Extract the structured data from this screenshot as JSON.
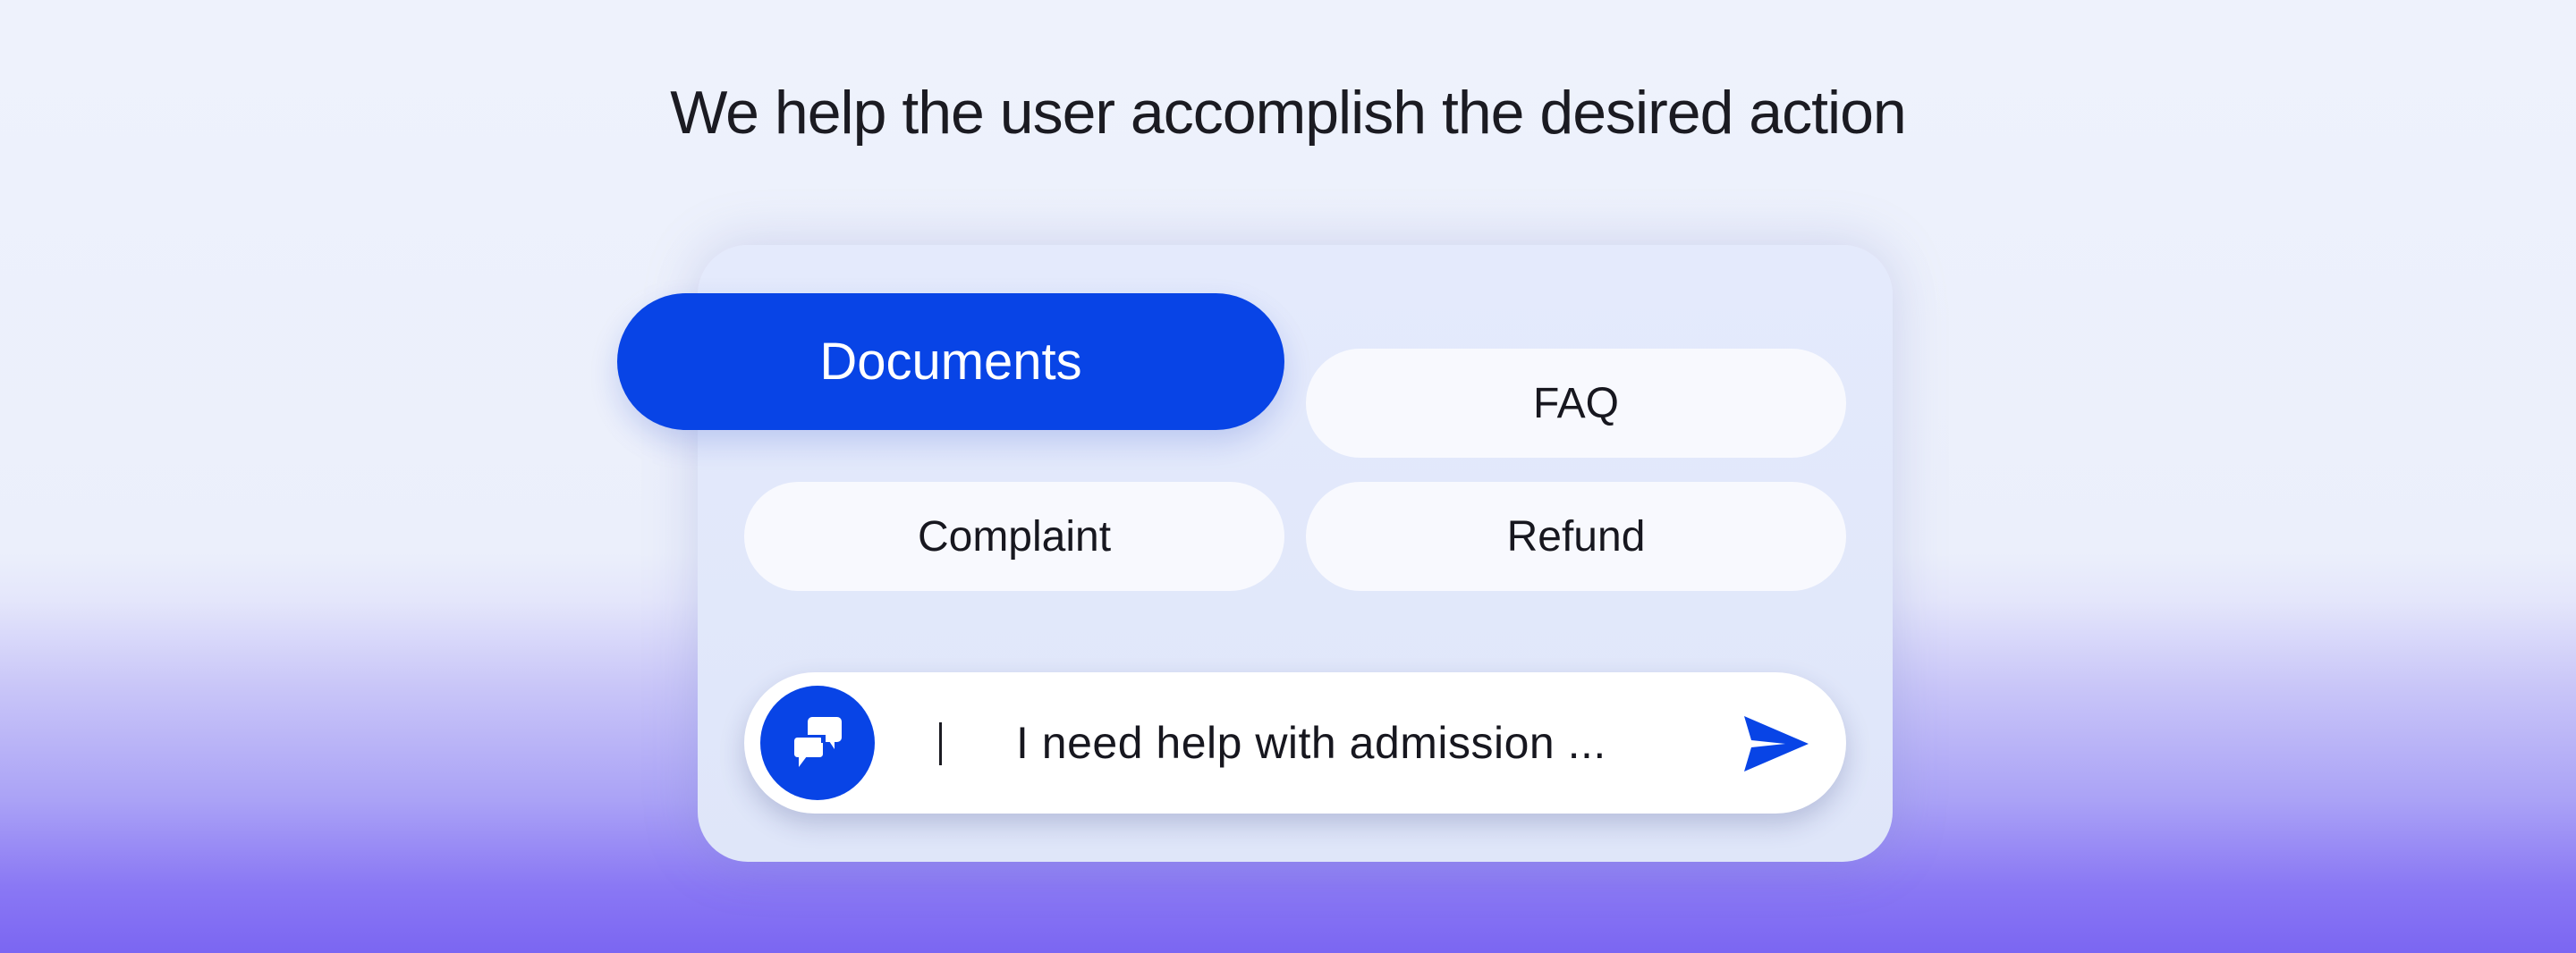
{
  "headline": "We help the user accomplish the desired action",
  "options": {
    "documents": "Documents",
    "faq": "FAQ",
    "complaint": "Complaint",
    "refund": "Refund"
  },
  "input": {
    "value": "I need help with admission ...",
    "chat_icon": "chat-bubbles-icon",
    "send_icon": "send-icon"
  },
  "colors": {
    "accent": "#0844e6",
    "pill_background": "#f8f9fe",
    "card_background": "#e2e8fb",
    "text": "#17171f"
  }
}
